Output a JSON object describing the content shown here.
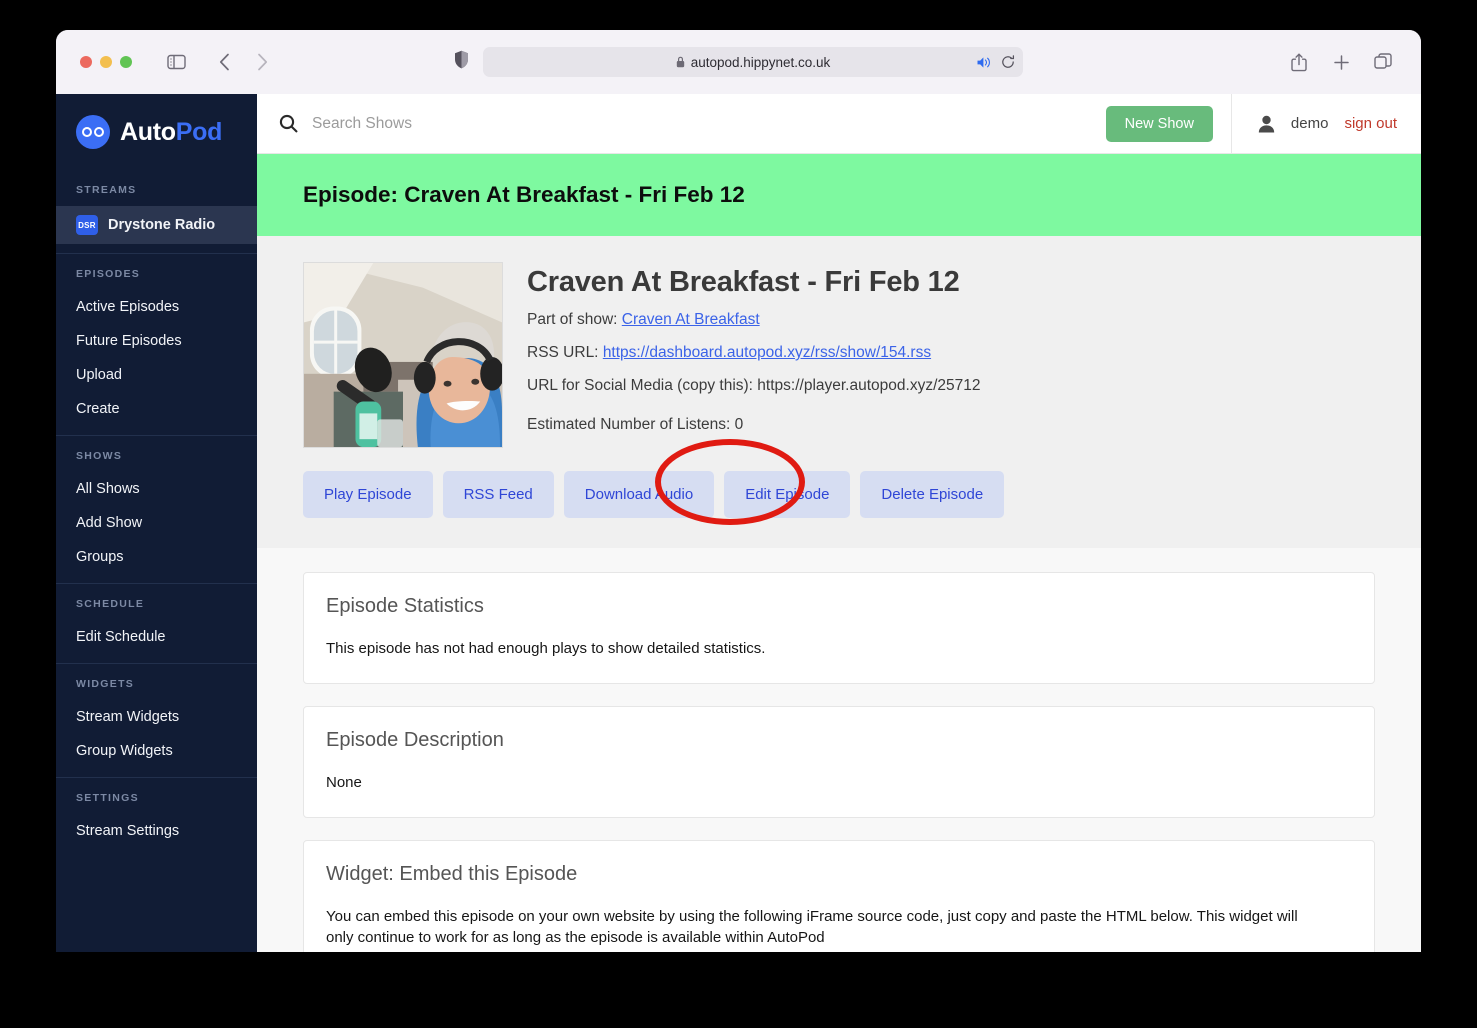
{
  "browser": {
    "url": "autopod.hippynet.co.uk",
    "lock_icon": "lock-icon",
    "shield_icon": "shield-icon",
    "speaker_icon": "speaker-icon",
    "reload_icon": "reload-icon",
    "sidebar_toggle_icon": "sidebar-toggle-icon",
    "back_icon": "back-arrow-icon",
    "forward_icon": "forward-arrow-icon",
    "share_icon": "share-icon",
    "new_tab_icon": "plus-icon",
    "tabs_icon": "tab-overview-icon"
  },
  "sidebar": {
    "logo": {
      "auto": "Auto",
      "pod": "Pod",
      "icon": "autopod-glasses-icon"
    },
    "sections": [
      {
        "label": "STREAMS",
        "items": [
          {
            "label": "Drystone Radio",
            "badge": "DSR",
            "active": true
          }
        ]
      },
      {
        "label": "EPISODES",
        "items": [
          {
            "label": "Active Episodes"
          },
          {
            "label": "Future Episodes"
          },
          {
            "label": "Upload"
          },
          {
            "label": "Create"
          }
        ]
      },
      {
        "label": "SHOWS",
        "items": [
          {
            "label": "All Shows"
          },
          {
            "label": "Add Show"
          },
          {
            "label": "Groups"
          }
        ]
      },
      {
        "label": "SCHEDULE",
        "items": [
          {
            "label": "Edit Schedule"
          }
        ]
      },
      {
        "label": "WIDGETS",
        "items": [
          {
            "label": "Stream Widgets"
          },
          {
            "label": "Group Widgets"
          }
        ]
      },
      {
        "label": "SETTINGS",
        "items": [
          {
            "label": "Stream Settings"
          }
        ]
      }
    ]
  },
  "topbar": {
    "search_placeholder": "Search Shows",
    "search_value": "",
    "search_icon": "search-icon",
    "new_show_label": "New Show",
    "user_icon": "person-icon",
    "user_name": "demo",
    "sign_out_label": "sign out"
  },
  "banner": {
    "title": "Episode: Craven At Breakfast - Fri Feb 12",
    "color": "#7ef9a0"
  },
  "episode": {
    "title": "Craven At Breakfast - Fri Feb 12",
    "thumbnail_alt": "episode-artwork",
    "part_of_show_label": "Part of show:",
    "show_name": "Craven At Breakfast",
    "rss_label": "RSS URL:",
    "rss_url": "https://dashboard.autopod.xyz/rss/show/154.rss",
    "social_label": "URL for Social Media (copy this):",
    "social_url": "https://player.autopod.xyz/25712",
    "listens_label": "Estimated Number of Listens: 0",
    "buttons": [
      {
        "label": "Play Episode",
        "name": "play-episode-button"
      },
      {
        "label": "RSS Feed",
        "name": "rss-feed-button"
      },
      {
        "label": "Download Audio",
        "name": "download-audio-button"
      },
      {
        "label": "Edit Episode",
        "name": "edit-episode-button"
      },
      {
        "label": "Delete Episode",
        "name": "delete-episode-button"
      }
    ],
    "highlight": {
      "target": "Edit Episode",
      "color": "#e01b12"
    }
  },
  "cards": [
    {
      "title": "Episode Statistics",
      "text": "This episode has not had enough plays to show detailed statistics."
    },
    {
      "title": "Episode Description",
      "text": "None"
    },
    {
      "title": "Widget: Embed this Episode",
      "text": "You can embed this episode on your own website by using the following iFrame source code, just copy and paste the HTML below. This widget will only continue to work for as long as the episode is available within AutoPod"
    }
  ]
}
